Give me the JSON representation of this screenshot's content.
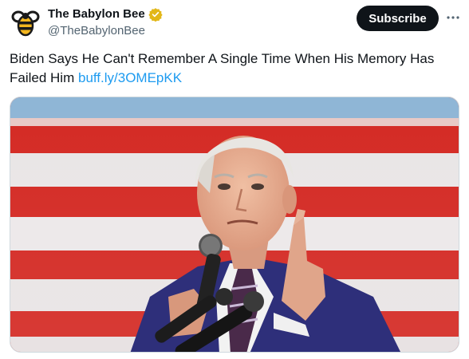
{
  "author": {
    "display_name": "The Babylon Bee",
    "handle": "@TheBabylonBee",
    "verified_icon": "verified-gold-check-icon",
    "avatar_icon": "bee-logo-icon"
  },
  "actions": {
    "subscribe_label": "Subscribe",
    "more_icon": "more-horizontal-icon"
  },
  "tweet": {
    "text": "Biden Says He Can't Remember A Single Time When His Memory Has Failed Him",
    "link_text": "buff.ly/3OMEpKK"
  },
  "media": {
    "description_icon": "photo-biden-speaking-flag-background"
  },
  "colors": {
    "link": "#1d9bf0",
    "subscribe_bg": "#0f1419",
    "verified": "#e2b719"
  }
}
